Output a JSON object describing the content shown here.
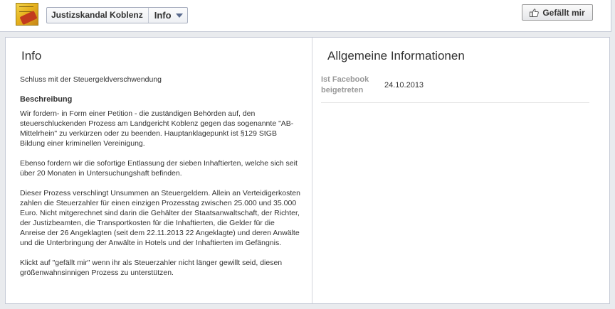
{
  "header": {
    "page_name": "Justizskandal Koblenz",
    "tab_label": "Info",
    "like_button_label": "Gefällt mir"
  },
  "info": {
    "title": "Info",
    "short_description": "Schluss mit der Steuergeldverschwendung",
    "description_heading": "Beschreibung",
    "paragraphs": [
      "Wir fordern- in Form einer Petition - die zuständigen Behörden auf, den steuerschluckenden Prozess am Landgericht Koblenz gegen das sogenannte \"AB-Mittelrhein\" zu verkürzen oder zu beenden. Hauptanklagepunkt ist §129 StGB Bildung einer kriminellen Vereinigung.",
      "Ebenso fordern wir die sofortige Entlassung der sieben Inhaftierten, welche sich seit über 20 Monaten in Untersuchungshaft befinden.",
      "Dieser Prozess verschlingt Unsummen an Steuergeldern. Allein an Verteidigerkosten zahlen die Steuerzahler für einen einzigen Prozesstag zwischen 25.000 und 35.000 Euro. Nicht mitgerechnet sind darin die Gehälter der Staatsanwaltschaft, der Richter, der Justizbeamten, die Transportkosten für die Inhaftierten, die Gelder für die Anreise der 26 Angeklagten (seit dem 22.11.2013 22 Angeklagte) und deren Anwälte und die Unterbringung der Anwälte in Hotels und der Inhaftierten im Gefängnis.",
      "Klickt auf \"gefällt mir\" wenn ihr als Steuerzahler nicht länger gewillt seid, diesen größenwahnsinnigen Prozess zu unterstützen."
    ]
  },
  "general": {
    "title": "Allgemeine Informationen",
    "joined_label": "Ist Facebook beigetreten",
    "joined_value": "24.10.2013"
  },
  "icons": {
    "like": "thumbs-up-icon",
    "dropdown": "chevron-down-icon"
  }
}
